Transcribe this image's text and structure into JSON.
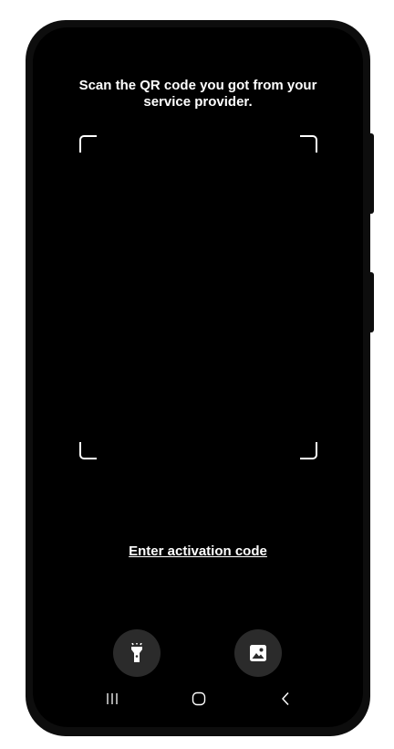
{
  "screen": {
    "instruction": "Scan the QR code you got from your service provider.",
    "activation_link_label": "Enter activation code"
  },
  "actions": {
    "flashlight_icon": "flashlight-icon",
    "gallery_icon": "image-gallery-icon"
  },
  "navigation": {
    "recents_icon": "recents-icon",
    "home_icon": "home-icon",
    "back_icon": "back-icon"
  },
  "colors": {
    "background": "#000000",
    "text": "#ffffff",
    "button_fill": "#2b2b2b",
    "frame": "#0d0d0d"
  }
}
